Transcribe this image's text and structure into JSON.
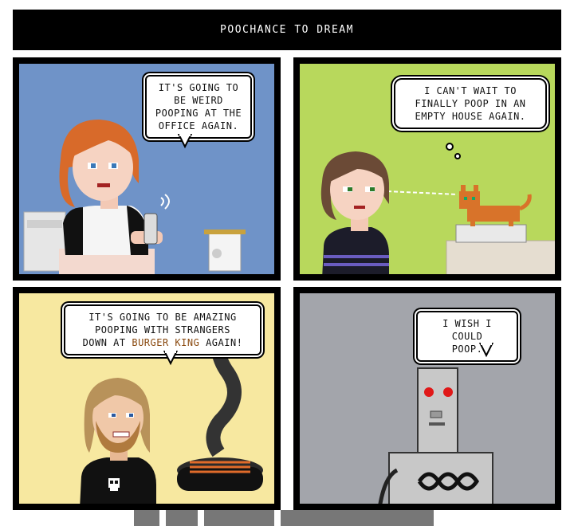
{
  "comic": {
    "title": "POOCHANCE TO DREAM"
  },
  "panels": [
    {
      "speech": [
        "IT'S GOING TO",
        "BE WEIRD",
        "POOPING AT THE",
        "OFFICE AGAIN."
      ]
    },
    {
      "thought": [
        "I CAN'T WAIT TO",
        "FINALLY POOP IN AN",
        "EMPTY HOUSE AGAIN."
      ]
    },
    {
      "speech_line1": "IT'S GOING TO BE AMAZING",
      "speech_line2": "POOPING WITH STRANGERS",
      "speech_line3_pre": "DOWN AT ",
      "speech_line3_brand": "BURGER KING",
      "speech_line3_post": " AGAIN!"
    },
    {
      "speech": [
        "I WISH I COULD",
        "POOP."
      ]
    }
  ],
  "colors": {
    "panel1_bg": "#6f93c8",
    "panel2_bg": "#b8d85c",
    "panel3_bg": "#f7e8a0",
    "panel4_bg": "#a3a5ab",
    "brand_text": "#8a4a10"
  }
}
